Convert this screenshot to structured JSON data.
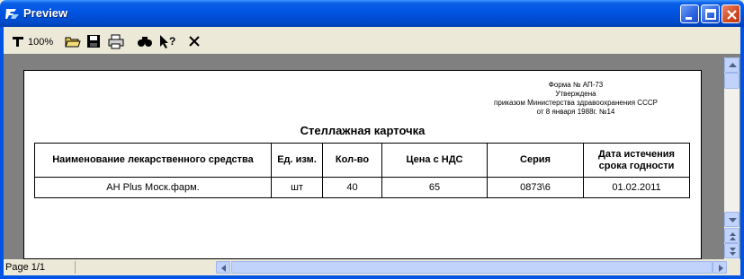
{
  "window": {
    "title": "Preview"
  },
  "toolbar": {
    "zoom_label": "100%"
  },
  "document": {
    "form_info": [
      "Форма № АП-73",
      "Утверждена",
      "приказом Министерства здравоохранения СССР",
      "от 8 января 1988г. №14"
    ],
    "title": "Стеллажная карточка",
    "table": {
      "headers": [
        "Наименование лекарственного средства",
        "Ед. изм.",
        "Кол-во",
        "Цена с НДС",
        "Серия",
        "Дата истечения срока годности"
      ],
      "rows": [
        [
          "АН Plus Моск.фарм.",
          "шт",
          "40",
          "65",
          "0873\\6",
          "01.02.2011"
        ]
      ]
    }
  },
  "status": {
    "page_label": "Page 1/1"
  },
  "colors": {
    "titlebar": "#0054E3",
    "window_bg": "#ECE9D8",
    "doc_bg": "#808080"
  }
}
